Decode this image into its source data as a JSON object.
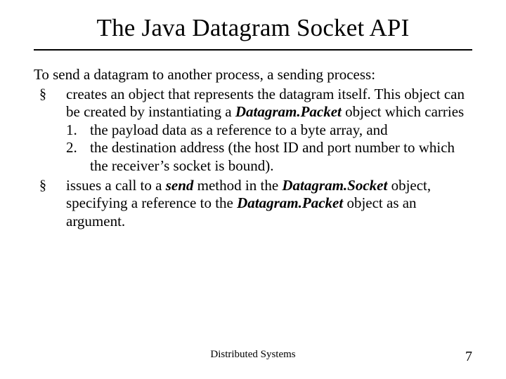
{
  "title": "The Java Datagram Socket API",
  "intro": "To send a datagram to another process, a sending process:",
  "bullets": [
    {
      "lead": "creates an object that represents the datagram itself.  This object can be created by  instantiating a ",
      "em1": "Datagram.Packet",
      "tail1": " object which carries",
      "numbered": [
        "the payload data as a reference to a byte array, and",
        "the destination address (the host ID and port number to which the receiver’s socket is bound)."
      ]
    },
    {
      "text_parts": [
        {
          "t": "issues a call to a "
        },
        {
          "t": "send",
          "bi": true
        },
        {
          "t": " method in the "
        },
        {
          "t": "Datagram.Socket",
          "bi": true
        },
        {
          "t": " object, specifying a reference to the "
        },
        {
          "t": "Datagram.Packet",
          "bi": true
        },
        {
          "t": " object as an argument."
        }
      ]
    }
  ],
  "footer": {
    "center": "Distributed Systems",
    "page": "7"
  }
}
